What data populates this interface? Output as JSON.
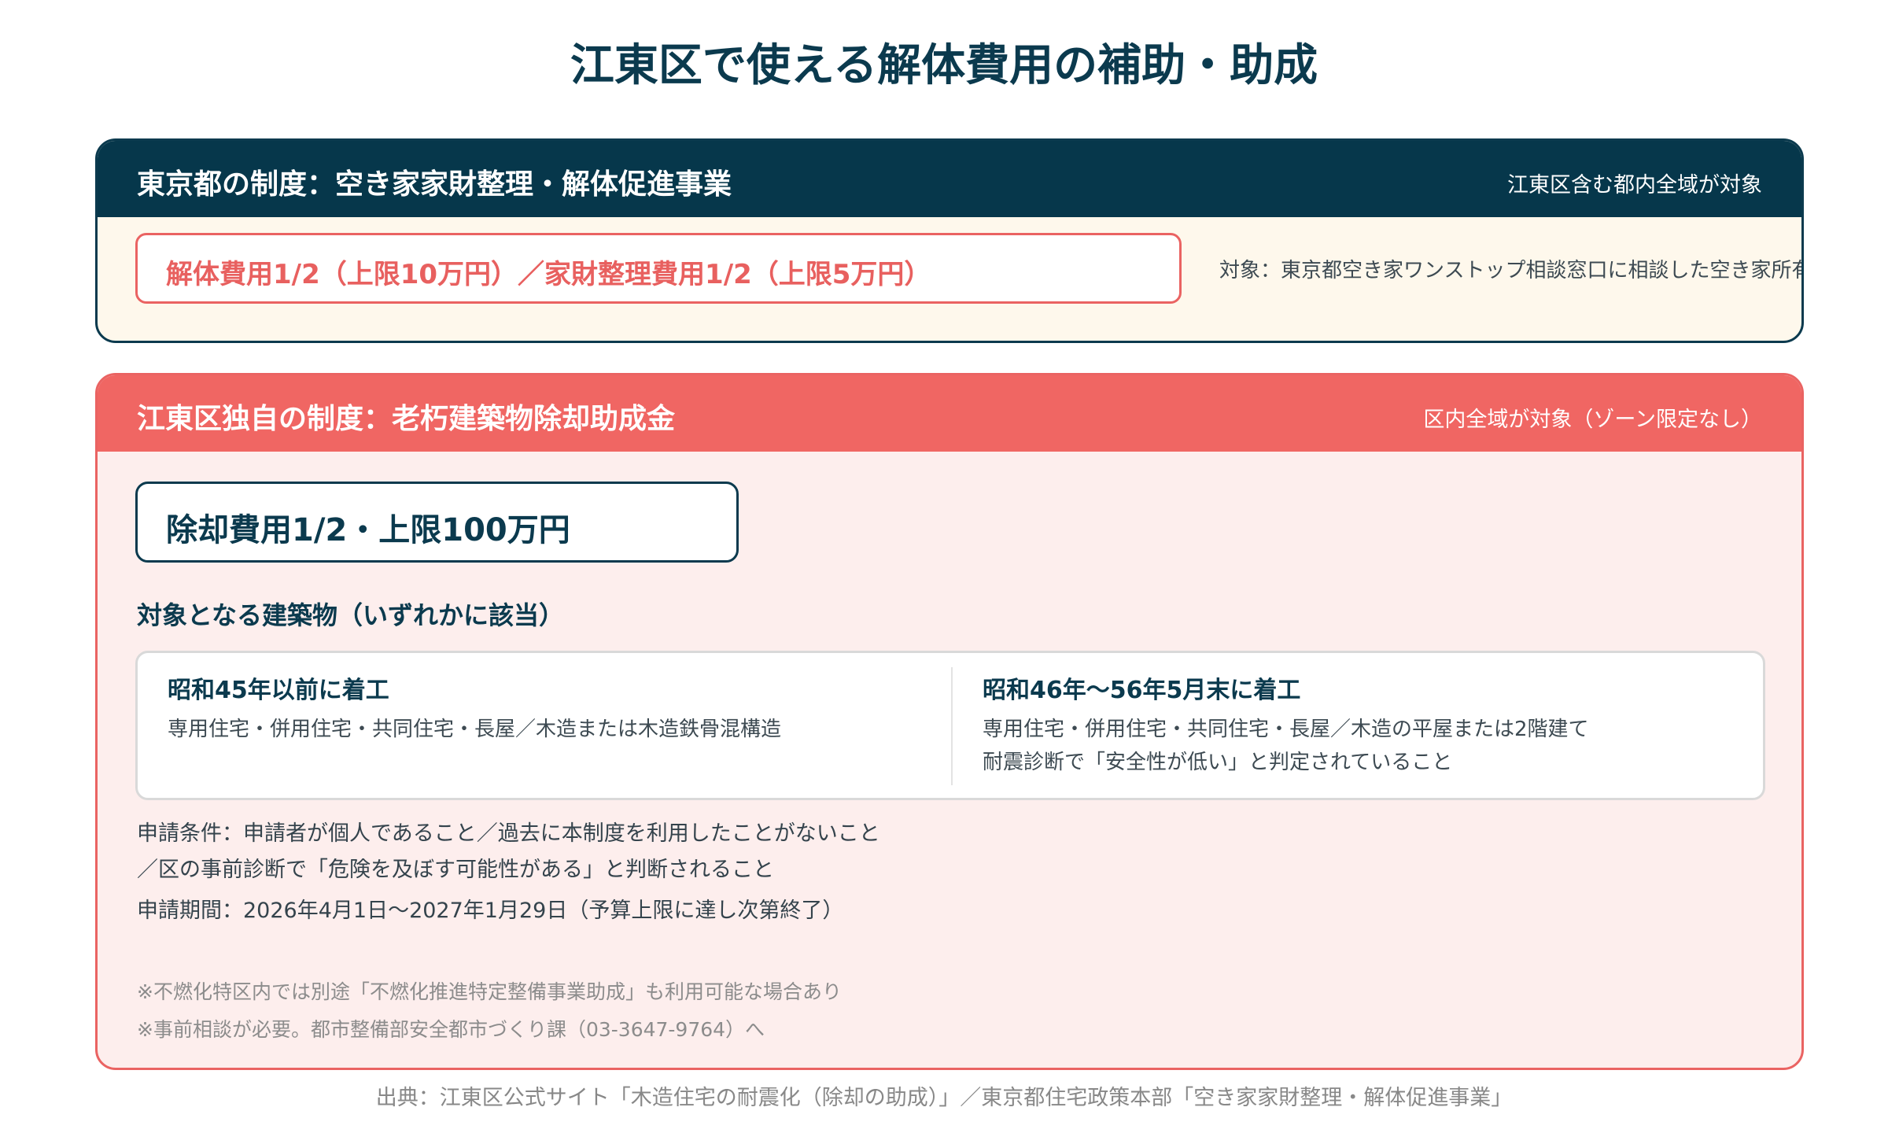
{
  "title": "江東区で使える解体費用の補助・助成",
  "tokyo": {
    "heading": "東京都の制度：空き家家財整理・解体促進事業",
    "scope": "江東区含む都内全域が対象",
    "subsidy": "解体費用1/2（上限10万円）／家財整理費用1/2（上限5万円）",
    "target": "対象：東京都空き家ワンストップ相談窓口に相談した空き家所有者"
  },
  "koto": {
    "heading": "江東区独自の制度：老朽建築物除却助成金",
    "scope": "区内全域が対象（ゾーン限定なし）",
    "amount": "除却費用1/2・上限100万円",
    "buildings_heading": "対象となる建築物（いずれかに該当）",
    "criteria": [
      {
        "title": "昭和45年以前に着工",
        "lines": [
          "専用住宅・併用住宅・共同住宅・長屋／木造または木造鉄骨混構造"
        ]
      },
      {
        "title": "昭和46年〜56年5月末に着工",
        "lines": [
          "専用住宅・併用住宅・共同住宅・長屋／木造の平屋または2階建て",
          "耐震診断で「安全性が低い」と判定されていること"
        ]
      }
    ],
    "conditions": [
      "申請条件：申請者が個人であること／過去に本制度を利用したことがないこと",
      "／区の事前診断で「危険を及ぼす可能性がある」と判断されること"
    ],
    "period": "申請期間：2026年4月1日〜2027年1月29日（予算上限に達し次第終了）",
    "notes": [
      "※不燃化特区内では別途「不燃化推進特定整備事業助成」も利用可能な場合あり",
      "※事前相談が必要。都市整備部安全都市づくり課（03-3647-9764）へ"
    ]
  },
  "source": "出典：江東区公式サイト「木造住宅の耐震化（除却の助成）」／東京都住宅政策本部「空き家家財整理・解体促進事業」",
  "colors": {
    "navy": "#06374b",
    "coral": "#f06663",
    "cream": "#fef8ec",
    "pink": "#fdeeed"
  }
}
